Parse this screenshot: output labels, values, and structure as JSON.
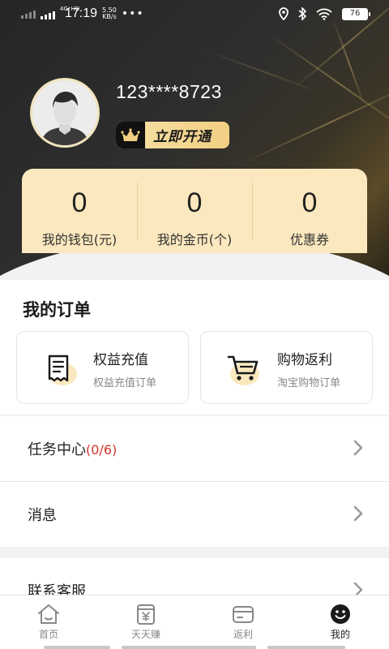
{
  "status_bar": {
    "network": "4G⁺HD",
    "time": "17:19",
    "speed_value": "5.50",
    "speed_unit": "KB/s",
    "more": "•••",
    "battery": "76"
  },
  "profile": {
    "phone": "123****8723",
    "vip_button_label": "立即开通"
  },
  "stats": [
    {
      "value": "0",
      "label": "我的钱包(元)"
    },
    {
      "value": "0",
      "label": "我的金币(个)"
    },
    {
      "value": "0",
      "label": "优惠券"
    }
  ],
  "orders": {
    "title": "我的订单",
    "cards": [
      {
        "title": "权益充值",
        "subtitle": "权益充值订单",
        "icon": "receipt-icon"
      },
      {
        "title": "购物返利",
        "subtitle": "淘宝购物订单",
        "icon": "shopping-cart-icon"
      }
    ]
  },
  "menu": [
    {
      "label": "任务中心",
      "count": "(0/6)"
    },
    {
      "label": "消息"
    },
    {
      "label": "联系客服"
    }
  ],
  "tabs": [
    {
      "label": "首页",
      "icon": "home-icon"
    },
    {
      "label": "天天赚",
      "icon": "yen-cup-icon"
    },
    {
      "label": "返利",
      "icon": "wallet-card-icon"
    },
    {
      "label": "我的",
      "icon": "smiley-face-icon",
      "active": true
    }
  ],
  "colors": {
    "accent_gold": "#f1cf82",
    "stats_card": "#fbe8be",
    "count_red": "#d0342c",
    "header_dark": "#2b2b2b"
  }
}
